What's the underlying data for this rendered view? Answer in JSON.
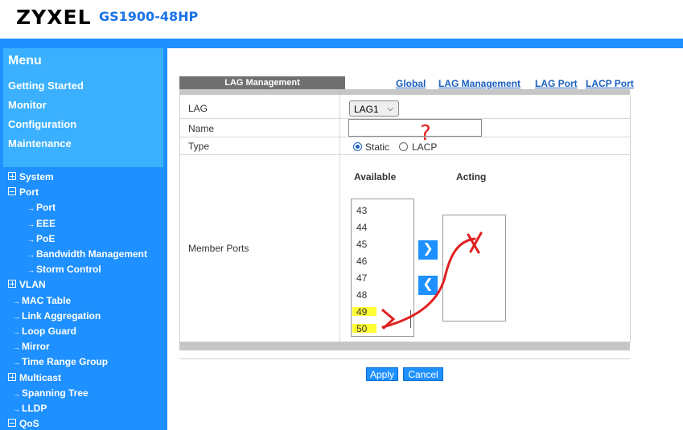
{
  "header": {
    "brand": "ZYXEL",
    "model": "GS1900-48HP"
  },
  "sidebar": {
    "title": "Menu",
    "top_links": [
      "Getting Started",
      "Monitor",
      "Configuration",
      "Maintenance"
    ],
    "tree": [
      {
        "label": "System",
        "type": "plus",
        "indent": 0
      },
      {
        "label": "Port",
        "type": "minus",
        "indent": 0
      },
      {
        "label": "Port",
        "type": "leaf",
        "indent": 2
      },
      {
        "label": "EEE",
        "type": "leaf",
        "indent": 2
      },
      {
        "label": "PoE",
        "type": "leaf",
        "indent": 2
      },
      {
        "label": "Bandwidth Management",
        "type": "leaf",
        "indent": 2
      },
      {
        "label": "Storm Control",
        "type": "leaf",
        "indent": 2
      },
      {
        "label": "VLAN",
        "type": "plus",
        "indent": 0
      },
      {
        "label": "MAC Table",
        "type": "leaf",
        "indent": 1
      },
      {
        "label": "Link Aggregation",
        "type": "leaf",
        "indent": 1
      },
      {
        "label": "Loop Guard",
        "type": "leaf",
        "indent": 1
      },
      {
        "label": "Mirror",
        "type": "leaf",
        "indent": 1
      },
      {
        "label": "Time Range Group",
        "type": "leaf",
        "indent": 1
      },
      {
        "label": "Multicast",
        "type": "plus",
        "indent": 0
      },
      {
        "label": "Spanning Tree",
        "type": "leaf",
        "indent": 1
      },
      {
        "label": "LLDP",
        "type": "leaf",
        "indent": 1
      },
      {
        "label": "QoS",
        "type": "minus",
        "indent": 0
      }
    ]
  },
  "panel": {
    "tab_label": "LAG Management",
    "links": [
      "Global",
      "LAG Management",
      "LAG Port",
      "LACP Port"
    ]
  },
  "form": {
    "lag_label": "LAG",
    "lag_value": "LAG1",
    "name_label": "Name",
    "name_value": "",
    "type_label": "Type",
    "type_options": [
      "Static",
      "LACP"
    ],
    "type_selected": "Static",
    "member_label": "Member Ports",
    "available_label": "Available",
    "acting_label": "Acting",
    "available_ports": [
      "43",
      "44",
      "45",
      "46",
      "47",
      "48",
      "49",
      "50"
    ],
    "highlighted_ports": [
      "49",
      "50"
    ],
    "acting_ports": []
  },
  "buttons": {
    "apply": "Apply",
    "cancel": "Cancel"
  },
  "annotation": {
    "question_mark": "?",
    "annotation_color": "#e02020",
    "highlight_color": "#ffff33"
  }
}
